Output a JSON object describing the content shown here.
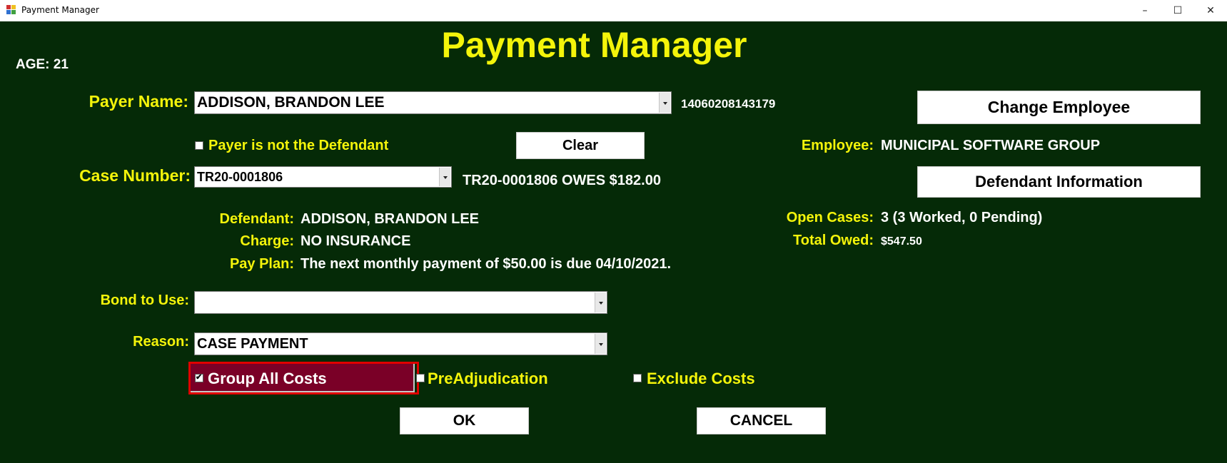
{
  "window": {
    "title": "Payment Manager",
    "minimize": "–",
    "maximize": "☐",
    "close": "✕"
  },
  "header": {
    "title": "Payment Manager",
    "age": "AGE: 21"
  },
  "payer": {
    "label": "Payer Name:",
    "value": "ADDISON, BRANDON LEE",
    "id": "14060208143179",
    "not_defendant_label": "Payer is not the Defendant",
    "not_defendant_checked": false
  },
  "buttons": {
    "change_employee": "Change Employee",
    "clear": "Clear",
    "defendant_info": "Defendant Information",
    "ok": "OK",
    "cancel": "CANCEL"
  },
  "employee": {
    "label": "Employee:",
    "value": "MUNICIPAL SOFTWARE GROUP"
  },
  "case": {
    "label": "Case Number:",
    "value": "TR20-0001806",
    "owes": "TR20-0001806 OWES $182.00"
  },
  "details": {
    "defendant_label": "Defendant:",
    "defendant": "ADDISON, BRANDON LEE",
    "charge_label": "Charge:",
    "charge": "NO INSURANCE",
    "payplan_label": "Pay Plan:",
    "payplan": "The next monthly payment of $50.00 is due 04/10/2021."
  },
  "summary": {
    "open_cases_label": "Open Cases:",
    "open_cases": "3 (3 Worked, 0 Pending)",
    "total_owed_label": "Total Owed:",
    "total_owed": "$547.50"
  },
  "bond": {
    "label": "Bond to Use:",
    "value": ""
  },
  "reason": {
    "label": "Reason:",
    "value": "CASE PAYMENT"
  },
  "options": {
    "group_all_costs": {
      "label": "Group All Costs",
      "checked": true
    },
    "preadjudication": {
      "label": "PreAdjudication",
      "checked": false
    },
    "exclude_costs": {
      "label": "Exclude Costs",
      "checked": false
    }
  },
  "colors": {
    "background": "#052a07",
    "label": "#f4f40a",
    "value": "#ffffff",
    "highlight_fill": "#7a0027",
    "highlight_border": "#e00000"
  }
}
